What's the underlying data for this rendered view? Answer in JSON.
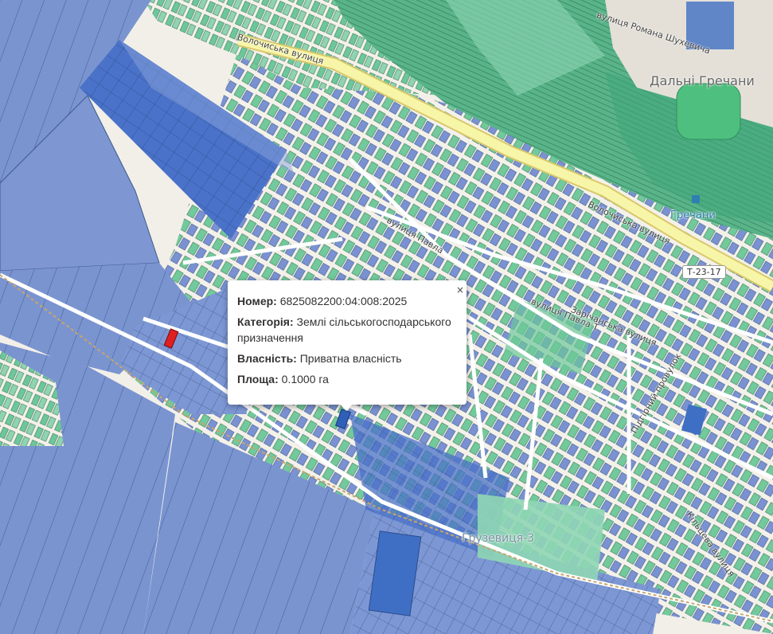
{
  "colors": {
    "water": "#a9d3df",
    "forest": "#7fc8a4",
    "parcel_green": "#6cc79a",
    "parcel_blue": "#6f8ed2",
    "parcel_dark": "#3d68c4",
    "selected": "#e02020",
    "road_main": "#f7f5a8",
    "road": "#ffffff"
  },
  "map": {
    "street_labels": [
      "Волочиська вулиця",
      "Волочиська вулиця",
      "вулиця Романа Шухевича",
      "вулиця Павла Т",
      "Зарічанська вулиця",
      "вулиця Павла",
      "Підгірний провулок",
      "Кільцева вулиця"
    ],
    "place_labels": [
      "Дальні Гречани",
      "Грузевиця-3"
    ],
    "station_label": "Гречани",
    "route_shield": "Т-23-17"
  },
  "popup": {
    "close_label": "×",
    "number_label": "Номер:",
    "number_value": "6825082200:04:008:2025",
    "category_label": "Категорія:",
    "category_value": "Землі сільськогосподарського призначення",
    "ownership_label": "Власність:",
    "ownership_value": "Приватна власність",
    "area_label": "Площа:",
    "area_value": "0.1000 га"
  }
}
